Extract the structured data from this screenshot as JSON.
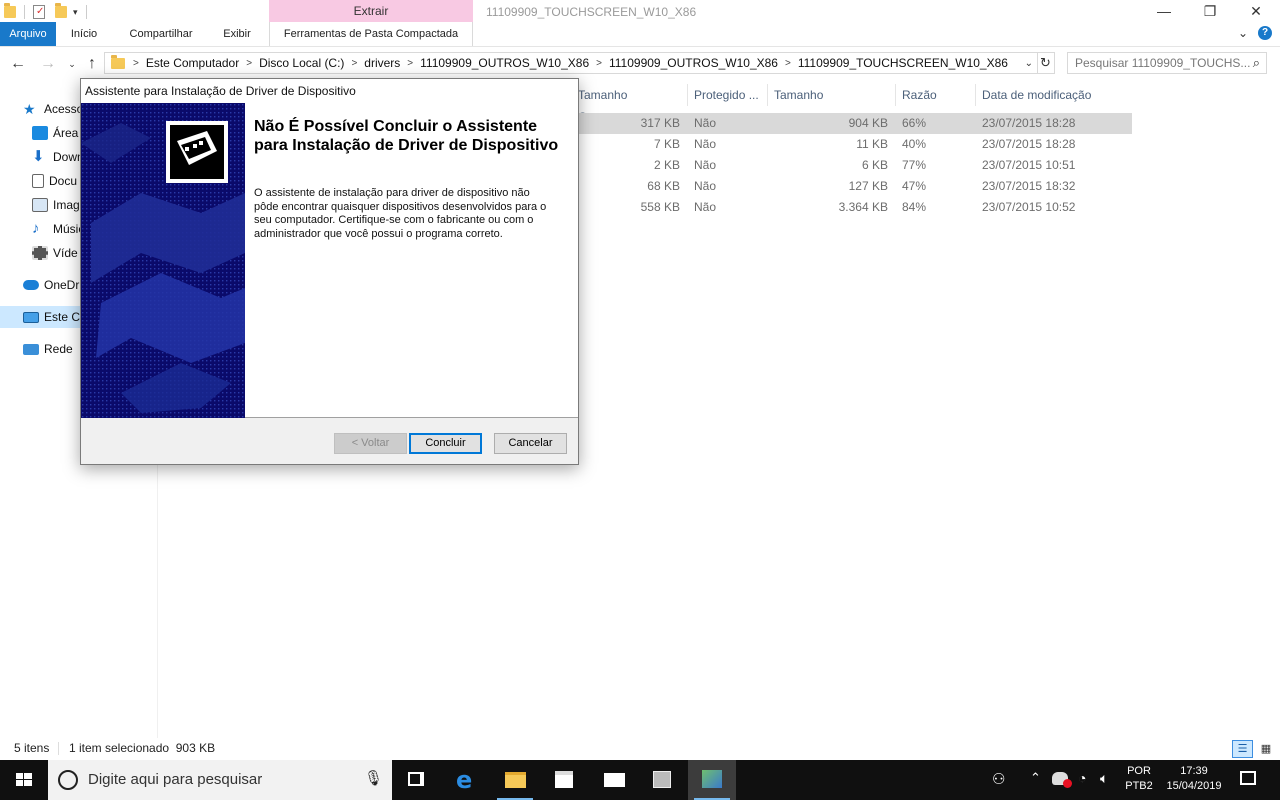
{
  "window": {
    "title": "11109909_TOUCHSCREEN_W10_X86",
    "context_tab": "Extrair"
  },
  "ribbon": {
    "tabs": [
      "Arquivo",
      "Início",
      "Compartilhar",
      "Exibir",
      "Ferramentas de Pasta Compactada"
    ]
  },
  "address": {
    "crumbs": [
      "Este Computador",
      "Disco Local (C:)",
      "drivers",
      "11109909_OUTROS_W10_X86",
      "11109909_OUTROS_W10_X86",
      "11109909_TOUCHSCREEN_W10_X86"
    ],
    "search_placeholder": "Pesquisar 11109909_TOUCHS..."
  },
  "nav": {
    "items": [
      {
        "label": "Acesso",
        "icon": "star-icon"
      },
      {
        "label": "Área",
        "icon": "desktop-icon"
      },
      {
        "label": "Down",
        "icon": "download-icon"
      },
      {
        "label": "Docu",
        "icon": "document-icon"
      },
      {
        "label": "Imag",
        "icon": "image-icon"
      },
      {
        "label": "Músic",
        "icon": "music-icon"
      },
      {
        "label": "Víde",
        "icon": "video-icon"
      },
      {
        "label": "OneDr",
        "icon": "cloud-icon"
      },
      {
        "label": "Este Co",
        "icon": "computer-icon"
      },
      {
        "label": "Rede",
        "icon": "network-icon"
      }
    ]
  },
  "files": {
    "columns": [
      "Tamanho Compact...",
      "Protegido ...",
      "Tamanho",
      "Razão",
      "Data de modificação"
    ],
    "rows": [
      {
        "compact": "317 KB",
        "protected": "Não",
        "size": "904 KB",
        "ratio": "66%",
        "date": "23/07/2015 18:28"
      },
      {
        "compact": "7 KB",
        "protected": "Não",
        "size": "11 KB",
        "ratio": "40%",
        "date": "23/07/2015 18:28"
      },
      {
        "compact": "2 KB",
        "protected": "Não",
        "size": "6 KB",
        "ratio": "77%",
        "date": "23/07/2015 10:51"
      },
      {
        "compact": "68 KB",
        "protected": "Não",
        "size": "127 KB",
        "ratio": "47%",
        "date": "23/07/2015 18:32"
      },
      {
        "compact": "558 KB",
        "protected": "Não",
        "size": "3.364 KB",
        "ratio": "84%",
        "date": "23/07/2015 10:52"
      }
    ]
  },
  "status": {
    "count": "5 itens",
    "selection": "1 item selecionado  903 KB"
  },
  "dialog": {
    "title": "Assistente para Instalação de Driver de Dispositivo",
    "heading": "Não É Possível Concluir o Assistente para Instalação de Driver de Dispositivo",
    "body": "O assistente de instalação para driver de dispositivo não pôde encontrar quaisquer dispositivos desenvolvidos para o seu computador.  Certifique-se com o fabricante ou com o administrador que você possui o programa correto.",
    "back_label": "< Voltar",
    "finish_label": "Concluir",
    "cancel_label": "Cancelar"
  },
  "taskbar": {
    "search_placeholder": "Digite aqui para pesquisar",
    "lang_top": "POR",
    "lang_bottom": "PTB2",
    "time": "17:39",
    "date": "15/04/2019"
  },
  "colors": {
    "accent": "#1979ca",
    "banner": "#0a0a6a",
    "selection": "#cce8ff",
    "context_tab": "#f8c9e3"
  }
}
